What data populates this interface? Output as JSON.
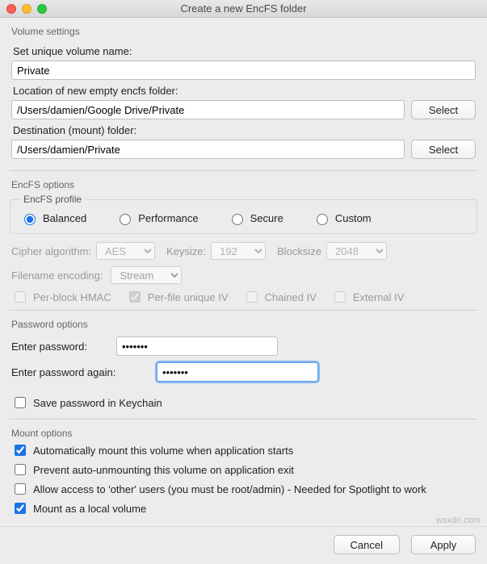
{
  "window": {
    "title": "Create a new EncFS folder"
  },
  "volume": {
    "group_label": "Volume settings",
    "name_label": "Set unique volume name:",
    "name_value": "Private",
    "location_label": "Location of new empty encfs folder:",
    "location_value": "/Users/damien/Google Drive/Private",
    "destination_label": "Destination (mount) folder:",
    "destination_value": "/Users/damien/Private",
    "select_button": "Select"
  },
  "encfs": {
    "group_label": "EncFS options",
    "profile_legend": "EncFS profile",
    "profiles": {
      "balanced": "Balanced",
      "performance": "Performance",
      "secure": "Secure",
      "custom": "Custom"
    },
    "selected_profile": "balanced",
    "cipher_label": "Cipher algorithm:",
    "cipher_value": "AES",
    "keysize_label": "Keysize:",
    "keysize_value": "192",
    "blocksize_label": "Blocksize",
    "blocksize_value": "2048",
    "filename_encoding_label": "Filename encoding:",
    "filename_encoding_value": "Stream",
    "adv": {
      "per_block_hmac": "Per-block HMAC",
      "per_file_iv": "Per-file unique IV",
      "chained_iv": "Chained IV",
      "external_iv": "External IV"
    }
  },
  "password": {
    "group_label": "Password options",
    "enter_label": "Enter password:",
    "enter_value": "●●●●●●●",
    "again_label": "Enter password again:",
    "again_value": "●●●●●●●",
    "keychain_label": "Save password in Keychain"
  },
  "mount": {
    "group_label": "Mount options",
    "auto_mount": "Automatically mount this volume when application starts",
    "prevent_unmount": "Prevent auto-unmounting this volume on application exit",
    "allow_other": "Allow access to 'other' users (you must be root/admin) - Needed for Spotlight to work",
    "local_volume": "Mount as a local volume"
  },
  "footer": {
    "cancel": "Cancel",
    "apply": "Apply"
  },
  "watermark": "wsxdn.com"
}
